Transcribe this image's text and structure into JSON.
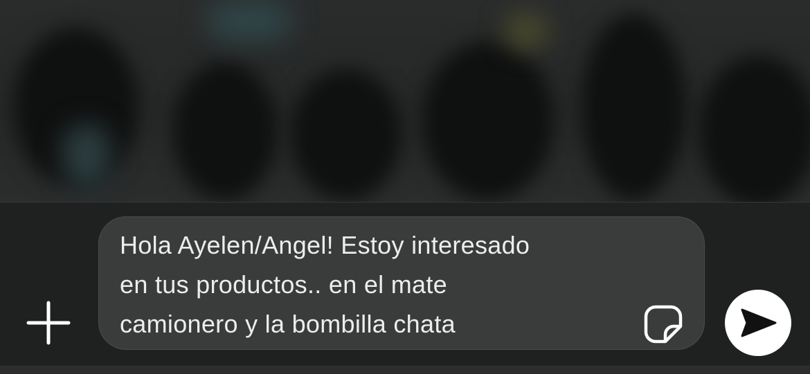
{
  "composer": {
    "message_lines": [
      "Hola Ayelen/Angel! Estoy interesado",
      "en tus productos.. en el mate",
      "camionero y la bombilla chata"
    ],
    "attach_icon": "plus-icon",
    "sticker_icon": "sticker-icon",
    "send_icon": "send-arrow-icon"
  },
  "colors": {
    "composer_background": "#1f2121",
    "input_background": "#3a3c3c",
    "text": "#eceded",
    "send_button": "#ffffff",
    "send_arrow": "#111111"
  }
}
